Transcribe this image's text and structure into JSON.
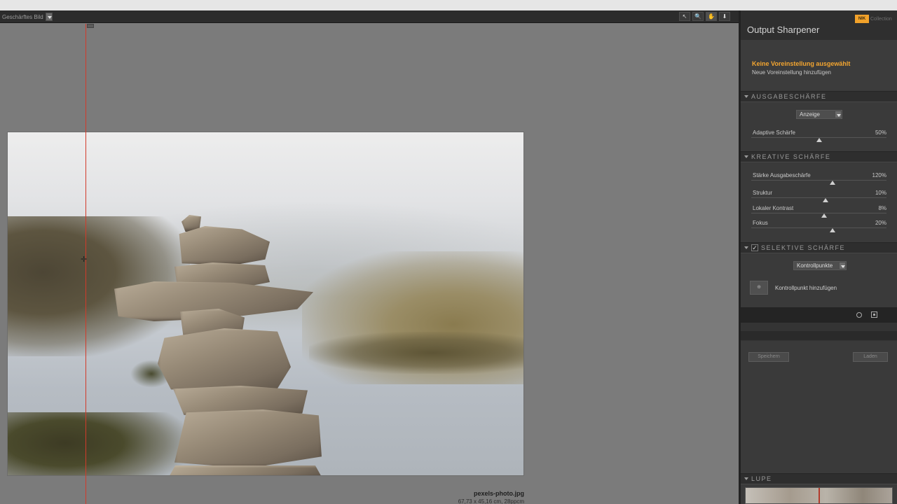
{
  "viewer": {
    "view_mode_label": "Geschärftes Bild",
    "tools": [
      {
        "name": "select-arrow-icon",
        "glyph": "↖"
      },
      {
        "name": "zoom-icon",
        "glyph": "🔍"
      },
      {
        "name": "hand-icon",
        "glyph": "✋"
      },
      {
        "name": "pin-icon",
        "glyph": "⬇"
      }
    ],
    "file_name": "pexels-photo.jpg",
    "file_dims": "67,73 x 45,16 cm, 28ppcm"
  },
  "panel": {
    "title": "Output Sharpener",
    "brand_logo": "NIK",
    "brand_text": "Collection",
    "preset_name": "Keine Voreinstellung ausgewählt",
    "preset_add": "Neue Voreinstellung hinzufügen",
    "sections": {
      "ausgabe": {
        "title": "AUSGABESCHÄRFE",
        "dropdown": "Anzeige",
        "sliders": [
          {
            "label": "Adaptive Schärfe",
            "value": "50%",
            "fraction": 0.5
          }
        ]
      },
      "kreativ": {
        "title": "KREATIVE SCHÄRFE",
        "sliders": [
          {
            "label": "Stärke Ausgabeschärfe",
            "value": "120%",
            "fraction": 0.6
          },
          {
            "label": "Struktur",
            "value": "10%",
            "fraction": 0.55
          },
          {
            "label": "Lokaler Kontrast",
            "value": "8%",
            "fraction": 0.54
          },
          {
            "label": "Fokus",
            "value": "20%",
            "fraction": 0.6
          }
        ]
      },
      "selektiv": {
        "title": "SELEKTIVE SCHÄRFE",
        "checked": true,
        "check_glyph": "✓",
        "dropdown": "Kontrollpunkte",
        "add_button_glyph": "⊕",
        "add_label": "Kontrollpunkt hinzufügen"
      },
      "lupe": {
        "title": "LUPE"
      }
    },
    "footer_buttons": [
      "Speichern",
      "Laden"
    ]
  }
}
